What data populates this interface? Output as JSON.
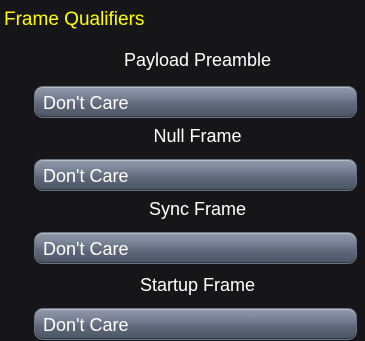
{
  "panel": {
    "title": "Frame Qualifiers"
  },
  "fields": [
    {
      "label": "Payload Preamble",
      "value": "Don't  Care"
    },
    {
      "label": "Null Frame",
      "value": "Don't  Care"
    },
    {
      "label": "Sync Frame",
      "value": "Don't  Care"
    },
    {
      "label": "Startup Frame",
      "value": "Don't  Care"
    }
  ],
  "colors": {
    "title": "#ffff00",
    "background": "#161618",
    "dropdown": "#7c8597"
  }
}
